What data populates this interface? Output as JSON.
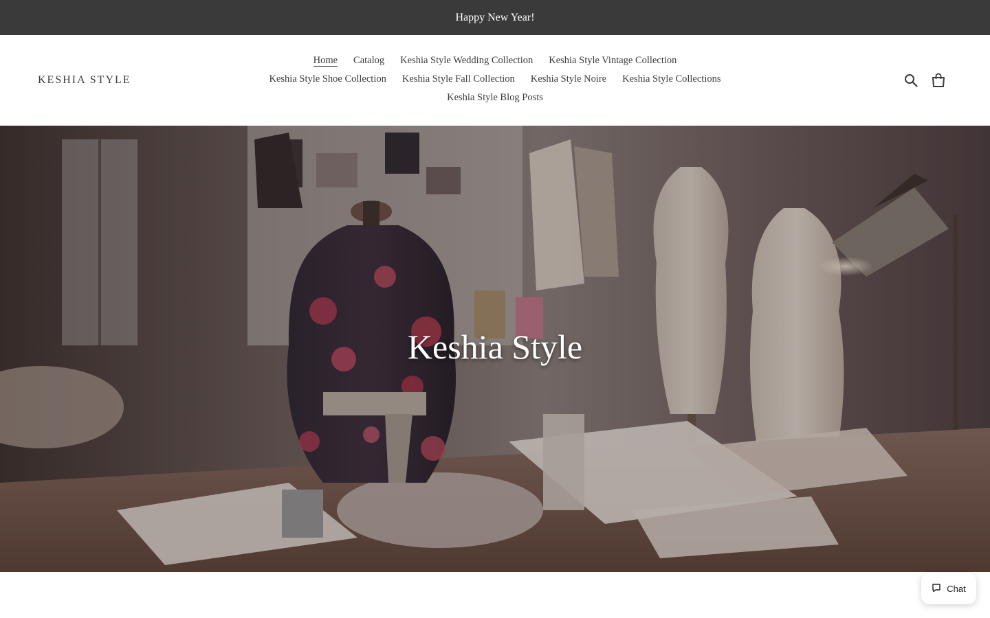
{
  "announcement": {
    "text": "Happy New Year!"
  },
  "header": {
    "logo": "KESHIA STYLE",
    "nav": [
      {
        "label": "Home",
        "active": true
      },
      {
        "label": "Catalog"
      },
      {
        "label": "Keshia Style Wedding Collection"
      },
      {
        "label": "Keshia Style Vintage Collection"
      },
      {
        "label": "Keshia Style Shoe Collection"
      },
      {
        "label": "Keshia Style Fall Collection"
      },
      {
        "label": "Keshia Style Noire"
      },
      {
        "label": "Keshia Style Collections"
      },
      {
        "label": "Keshia Style Blog Posts"
      }
    ],
    "icons": [
      "search-icon",
      "cart-icon"
    ]
  },
  "hero": {
    "title": "Keshia Style"
  },
  "chat": {
    "label": "Chat",
    "icon": "chat-bubble-icon"
  },
  "colors": {
    "announcement_bg": "#3a3a3a",
    "text": "#3a3a3a",
    "white": "#ffffff"
  }
}
